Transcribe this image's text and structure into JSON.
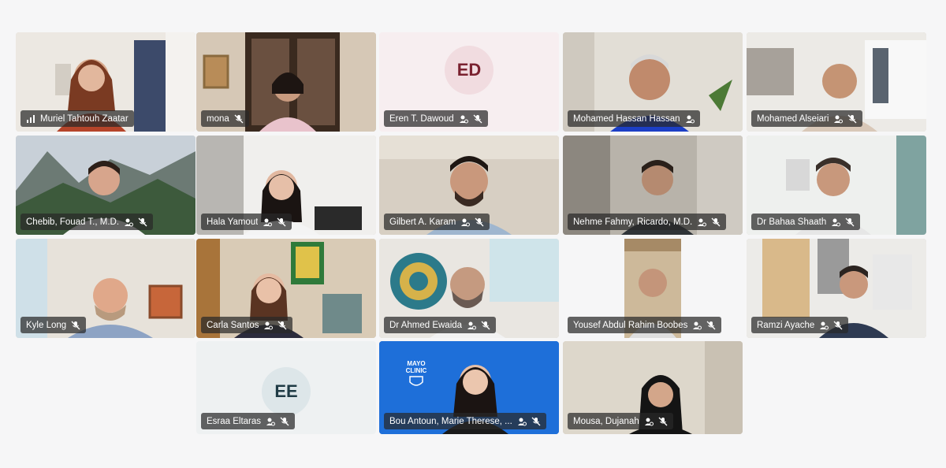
{
  "colors": {
    "page_bg": "#f6f6f7",
    "tile_dark_bar": "rgba(40,40,40,0.72)",
    "avatar_ed_bg": "#f3dfe2",
    "avatar_ed_text": "#7a2230",
    "avatar_ee_bg": "#dfe7ea",
    "avatar_ee_text": "#1f3b45",
    "mayo_blue": "#1e6fd9"
  },
  "participants": [
    {
      "name": "Muriel Tahtouh Zaatar",
      "lead_icon": "signal-bars-icon",
      "icons": []
    },
    {
      "name": "mona",
      "icons": [
        "mic-off-icon"
      ]
    },
    {
      "name": "Eren T. Dawoud",
      "initials": "ED",
      "icons": [
        "participant-icon",
        "mic-off-icon"
      ]
    },
    {
      "name": "Mohamed Hassan Hassan",
      "icons": [
        "participant-icon"
      ]
    },
    {
      "name": "Mohamed Alseiari",
      "icons": [
        "participant-icon",
        "mic-off-icon"
      ]
    },
    {
      "name": "Chebib, Fouad T., M.D.",
      "icons": [
        "participant-icon",
        "mic-off-icon"
      ]
    },
    {
      "name": "Hala Yamout",
      "icons": [
        "participant-icon",
        "mic-off-icon"
      ]
    },
    {
      "name": "Gilbert A. Karam",
      "icons": [
        "participant-icon",
        "mic-off-icon"
      ]
    },
    {
      "name": "Nehme Fahmy, Ricardo, M.D.",
      "icons": [
        "participant-icon",
        "mic-off-icon"
      ]
    },
    {
      "name": "Dr Bahaa Shaath",
      "icons": [
        "participant-icon",
        "mic-off-icon"
      ]
    },
    {
      "name": "Kyle Long",
      "icons": [
        "mic-off-icon"
      ]
    },
    {
      "name": "Carla Santos",
      "icons": [
        "participant-icon",
        "mic-off-icon"
      ]
    },
    {
      "name": "Dr Ahmed Ewaida",
      "icons": [
        "participant-icon",
        "mic-off-icon"
      ]
    },
    {
      "name": "Yousef Abdul Rahim Boobes",
      "icons": [
        "participant-icon",
        "mic-off-icon"
      ]
    },
    {
      "name": "Ramzi Ayache",
      "icons": [
        "participant-icon",
        "mic-off-icon"
      ]
    },
    {
      "name": "Esraa Eltaras",
      "initials": "EE",
      "icons": [
        "participant-icon",
        "mic-off-icon"
      ]
    },
    {
      "name": "Bou Antoun, Marie Therese, ...",
      "logo": "MAYO CLINIC",
      "icons": [
        "participant-icon",
        "mic-off-icon"
      ]
    },
    {
      "name": "Mousa, Dujanah",
      "icons": [
        "participant-icon",
        "mic-off-icon"
      ]
    }
  ]
}
